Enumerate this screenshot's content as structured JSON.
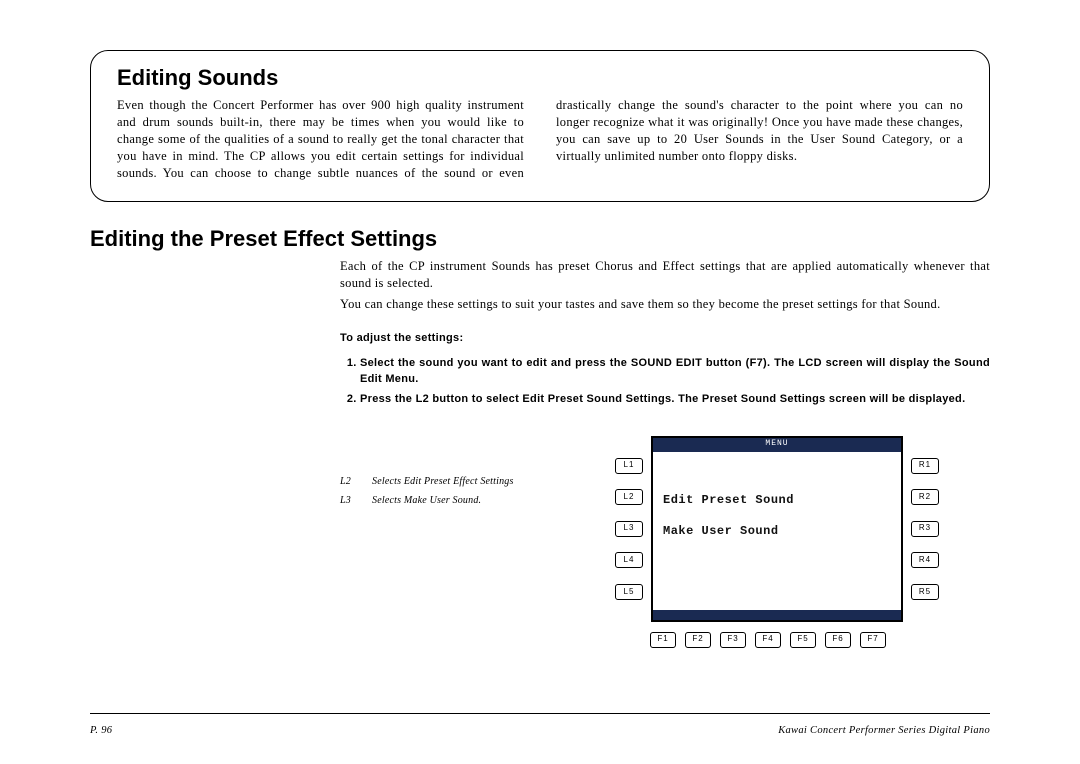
{
  "box": {
    "title": "Editing Sounds",
    "body": "Even though the Concert Performer has over 900 high quality instrument and drum sounds built-in, there may be times when you would like to change some of the qualities of a sound to really get the tonal character that you have in mind.  The CP allows you edit certain settings for individual sounds.  You can choose to change subtle nuances of the sound or even drastically change the sound's character to the point where you can no longer recognize what it was originally! Once you have made these changes, you can save up to 20 User Sounds in the User Sound Category, or a virtually unlimited number onto floppy disks."
  },
  "section": {
    "title": "Editing the Preset Effect Settings",
    "p1": "Each of the CP instrument Sounds has preset Chorus and Effect settings that are applied automatically whenever that sound is selected.",
    "p2": "You can change these settings to suit your tastes and save them so they become the preset settings for that  Sound.",
    "instr_title": "To adjust the settings:",
    "step1": "Select the sound you want to edit and press the SOUND EDIT button (F7).   The LCD screen will display the Sound Edit Menu.",
    "step2": "Press the L2 button to select Edit Preset Sound Settings.  The Preset Sound Settings screen will be displayed."
  },
  "legend": [
    {
      "key": "L2",
      "text": "Selects Edit Preset Effect Settings"
    },
    {
      "key": "L3",
      "text": "Selects Make User Sound."
    }
  ],
  "lcd": {
    "header": "MENU",
    "lines": [
      "",
      "Edit Preset Sound",
      "Make User Sound",
      "",
      ""
    ],
    "left": [
      "L1",
      "L2",
      "L3",
      "L4",
      "L5"
    ],
    "right": [
      "R1",
      "R2",
      "R3",
      "R4",
      "R5"
    ],
    "bottom": [
      "F1",
      "F2",
      "F3",
      "F4",
      "F5",
      "F6",
      "F7"
    ]
  },
  "footer": {
    "page": "P. 96",
    "title": "Kawai Concert Performer Series Digital Piano"
  }
}
